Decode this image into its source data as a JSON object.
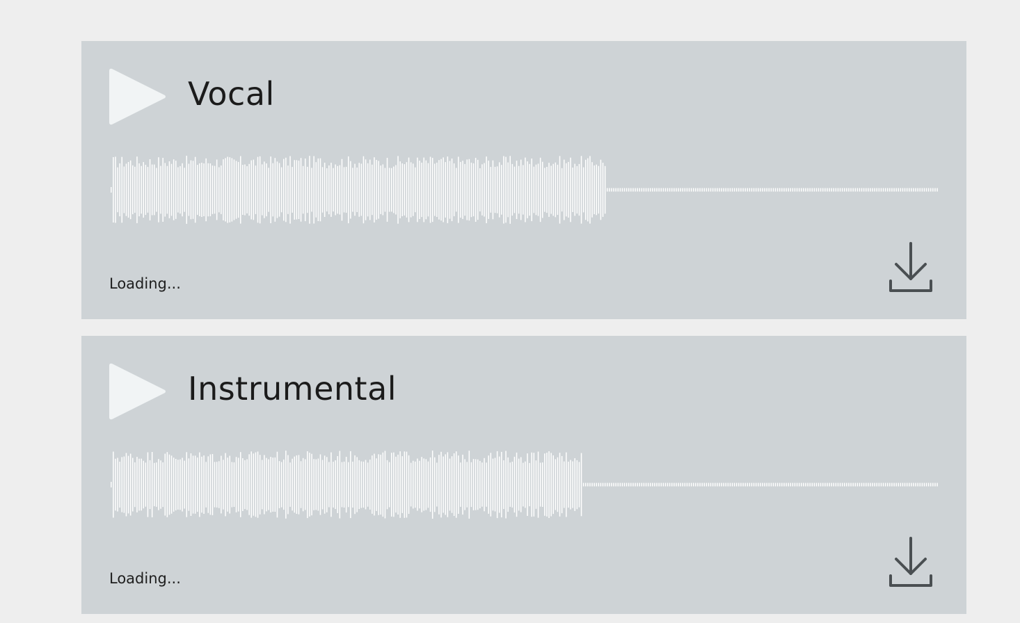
{
  "tracks": [
    {
      "title": "Vocal",
      "status": "Loading...",
      "progress": 0.6,
      "play_icon": "play-icon",
      "download_icon": "download-icon"
    },
    {
      "title": "Instrumental",
      "status": "Loading...",
      "progress": 0.57,
      "play_icon": "play-icon",
      "download_icon": "download-icon"
    }
  ],
  "colors": {
    "page_background": "#eeeeee",
    "card_background": "#ced3d6",
    "play_icon": "#f1f4f5",
    "waveform": "#ffffff",
    "download_icon": "#4a4f52",
    "text": "#1b1b1b"
  }
}
